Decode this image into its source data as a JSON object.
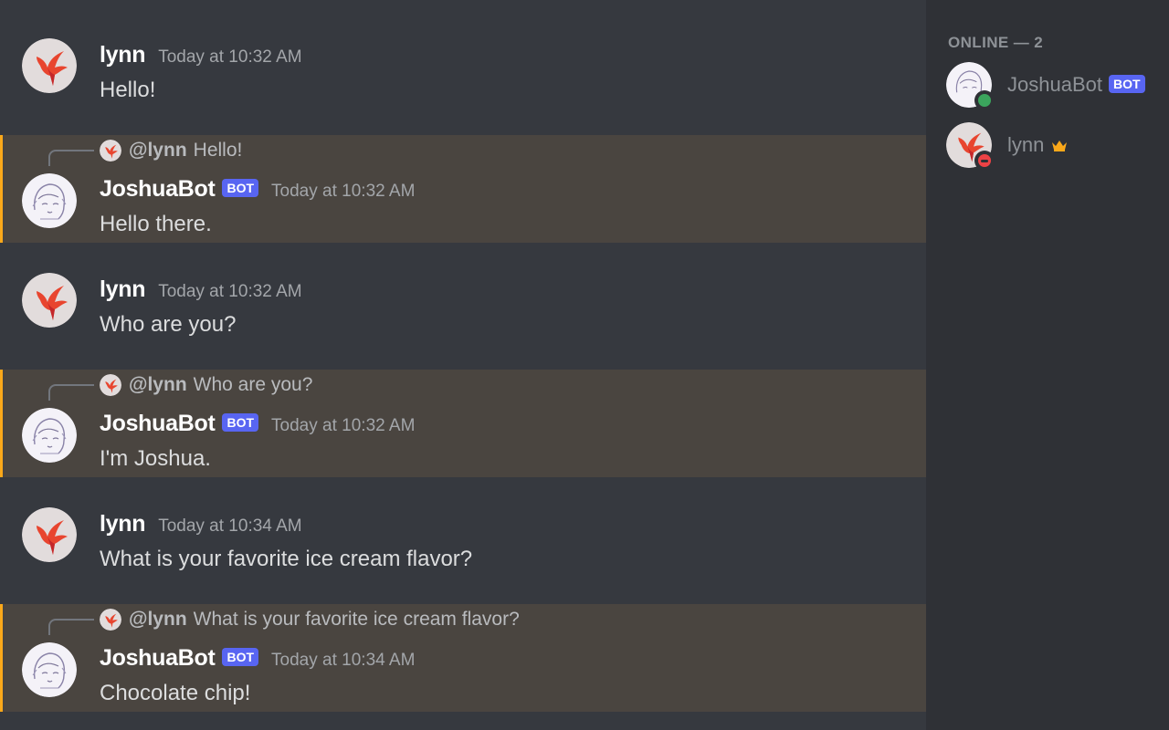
{
  "colors": {
    "chat_bg": "#36393f",
    "mention_bg": "#4a4540",
    "mention_bar": "#faa81a",
    "sidebar_bg": "#2f3136",
    "bot_tag": "#5865f2",
    "online": "#3ba55d",
    "dnd": "#ed4245",
    "crown": "#faa81a"
  },
  "messages": [
    {
      "author": "lynn",
      "avatar": "bird-avatar-icon",
      "timestamp": "Today at 10:32 AM",
      "content": "Hello!"
    },
    {
      "reply_author": "@lynn",
      "reply_text": "Hello!",
      "author": "JoshuaBot",
      "bot_tag": "BOT",
      "avatar": "sketch-avatar-icon",
      "timestamp": "Today at 10:32 AM",
      "content": "Hello there."
    },
    {
      "author": "lynn",
      "avatar": "bird-avatar-icon",
      "timestamp": "Today at 10:32 AM",
      "content": "Who are you?"
    },
    {
      "reply_author": "@lynn",
      "reply_text": "Who are you?",
      "author": "JoshuaBot",
      "bot_tag": "BOT",
      "avatar": "sketch-avatar-icon",
      "timestamp": "Today at 10:32 AM",
      "content": "I'm Joshua."
    },
    {
      "author": "lynn",
      "avatar": "bird-avatar-icon",
      "timestamp": "Today at 10:34 AM",
      "content": "What is your favorite ice cream flavor?"
    },
    {
      "reply_author": "@lynn",
      "reply_text": "What is your favorite ice cream flavor?",
      "author": "JoshuaBot",
      "bot_tag": "BOT",
      "avatar": "sketch-avatar-icon",
      "timestamp": "Today at 10:34 AM",
      "content": "Chocolate chip!"
    }
  ],
  "members": {
    "heading": "ONLINE — 2",
    "list": [
      {
        "name": "JoshuaBot",
        "bot_tag": "BOT",
        "status": "online",
        "avatar": "sketch-avatar-icon"
      },
      {
        "name": "lynn",
        "status": "dnd",
        "avatar": "bird-avatar-icon",
        "badge": "crown-icon"
      }
    ]
  }
}
